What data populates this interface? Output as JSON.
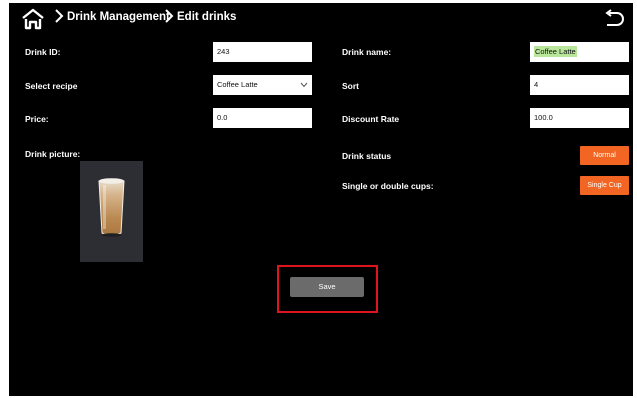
{
  "breadcrumb": [
    "Drink Management",
    "Edit drinks"
  ],
  "form": {
    "drink_id": {
      "label": "Drink ID:",
      "value": "243"
    },
    "drink_name": {
      "label": "Drink name:",
      "value": "Coffee Latte"
    },
    "recipe": {
      "label": "Select recipe",
      "value": "Coffee Latte"
    },
    "sort": {
      "label": "Sort",
      "value": "4"
    },
    "price": {
      "label": "Price:",
      "value": "0.0"
    },
    "discount": {
      "label": "Discount Rate",
      "value": "100.0"
    },
    "picture": {
      "label": "Drink picture:"
    },
    "status": {
      "label": "Drink status",
      "button": "Normal"
    },
    "cups": {
      "label": "Single or double cups:",
      "button": "Single Cup"
    }
  },
  "save_label": "Save",
  "colors": {
    "accent": "#f26522",
    "highlight": "#e0141e",
    "background": "#000000"
  }
}
